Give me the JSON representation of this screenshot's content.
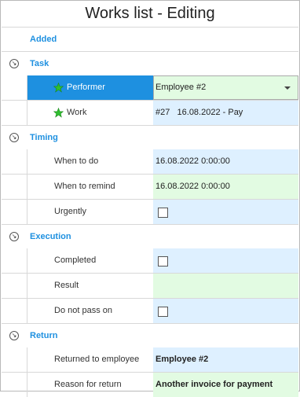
{
  "window": {
    "title": "Works list - Editing"
  },
  "categories": {
    "added": {
      "label": "Added"
    },
    "task": {
      "label": "Task"
    },
    "timing": {
      "label": "Timing"
    },
    "execution": {
      "label": "Execution"
    },
    "return": {
      "label": "Return"
    }
  },
  "fields": {
    "performer": {
      "label": "Performer",
      "value": "Employee #2"
    },
    "work": {
      "label": "Work",
      "value": "#27   16.08.2022 - Pay"
    },
    "when_to_do": {
      "label": "When to do",
      "value": "16.08.2022 0:00:00"
    },
    "when_to_remind": {
      "label": "When to remind",
      "value": "16.08.2022 0:00:00"
    },
    "urgently": {
      "label": "Urgently",
      "checked": false
    },
    "completed": {
      "label": "Completed",
      "checked": false
    },
    "result": {
      "label": "Result",
      "value": ""
    },
    "do_not_pass_on": {
      "label": "Do not pass on",
      "checked": false
    },
    "returned_to_employee": {
      "label": "Returned to employee",
      "value": "Employee #2"
    },
    "reason_for_return": {
      "label": "Reason for return",
      "value": "Another invoice for payment"
    }
  },
  "colors": {
    "accent": "#1e90e0",
    "value_blue": "#def0ff",
    "value_green": "#e2fbe2",
    "star_green": "#2fbf2f"
  }
}
